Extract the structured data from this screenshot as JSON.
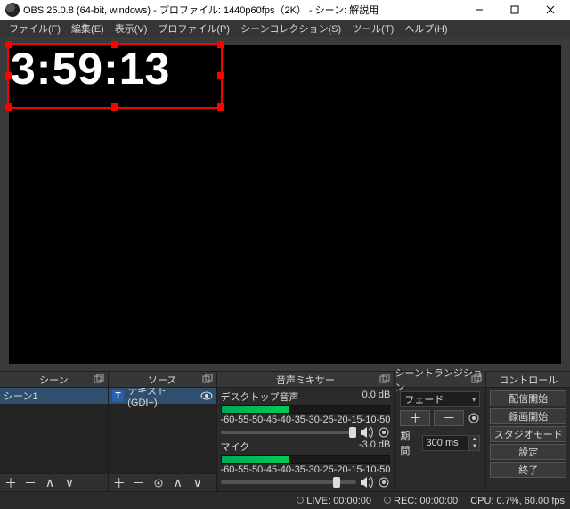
{
  "title": "OBS 25.0.8 (64-bit, windows) - プロファイル: 1440p60fps（2K） - シーン: 解説用",
  "menu": {
    "file": "ファイル(F)",
    "edit": "編集(E)",
    "view": "表示(V)",
    "profile": "プロファイル(P)",
    "scenecol": "シーンコレクション(S)",
    "tools": "ツール(T)",
    "help": "ヘルプ(H)"
  },
  "timer_text": "3:59:13",
  "panels": {
    "scenes": {
      "title": "シーン",
      "items": [
        "シーン1"
      ]
    },
    "sources": {
      "title": "ソース",
      "items": [
        {
          "label": "テキスト (GDI+)"
        }
      ]
    },
    "mixer": {
      "title": "音声ミキサー",
      "channels": [
        {
          "name": "デスクトップ音声",
          "db": "0.0 dB"
        },
        {
          "name": "マイク",
          "db": "-3.0 dB"
        }
      ],
      "scale": [
        "-60",
        "-55",
        "-50",
        "-45",
        "-40",
        "-35",
        "-30",
        "-25",
        "-20",
        "-15",
        "-10",
        "-5",
        "0"
      ]
    },
    "transition": {
      "title": "シーントランジション",
      "selected": "フェード",
      "duration_label": "期間",
      "duration": "300 ms"
    },
    "controls": {
      "title": "コントロール",
      "buttons": [
        "配信開始",
        "録画開始",
        "スタジオモード",
        "設定",
        "終了"
      ]
    }
  },
  "status": {
    "live_label": "LIVE:",
    "live": "00:00:00",
    "rec_label": "REC:",
    "rec": "00:00:00",
    "cpu_label": "CPU:",
    "cpu": "0.7%,",
    "fps": "60.00 fps"
  }
}
